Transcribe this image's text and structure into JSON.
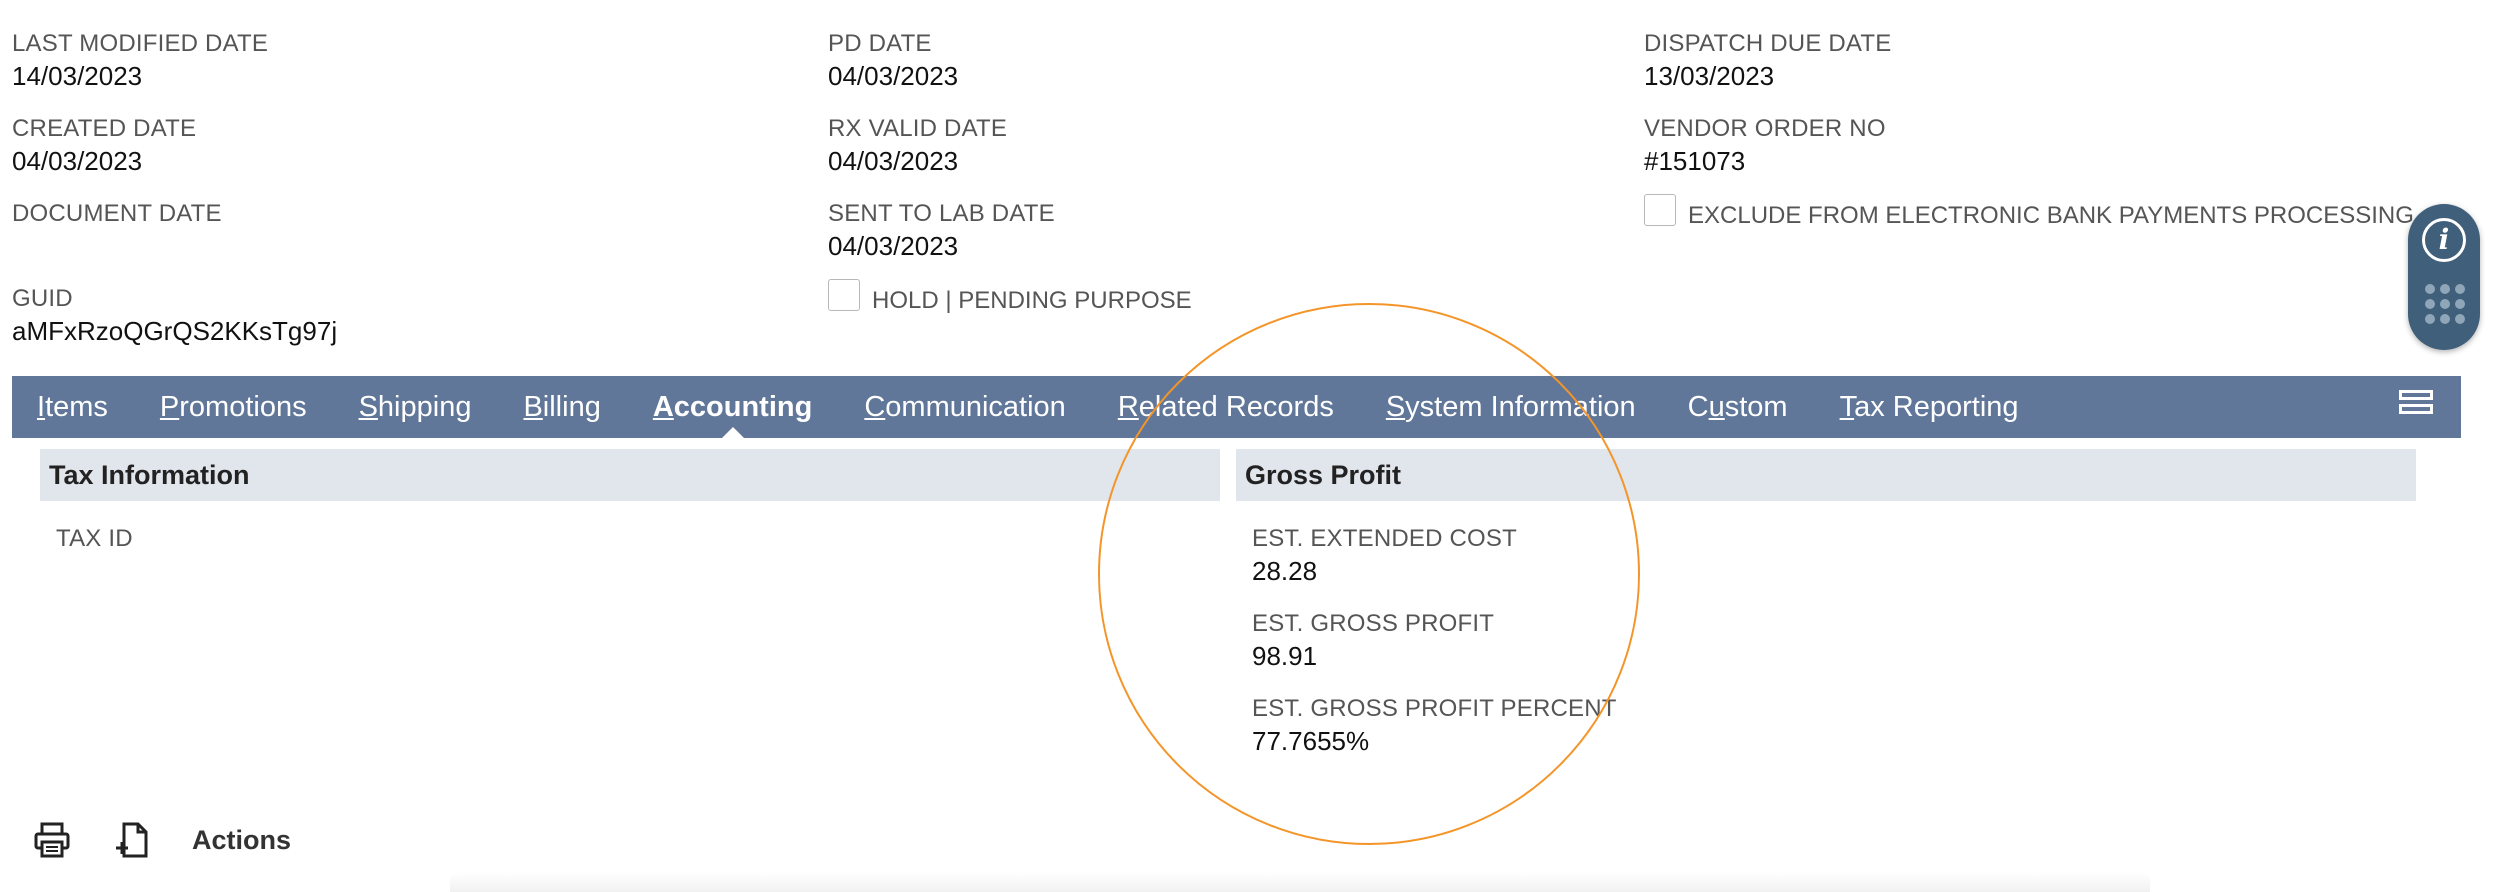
{
  "fields": {
    "last_modified": {
      "label": "LAST MODIFIED DATE",
      "value": "14/03/2023"
    },
    "created": {
      "label": "CREATED DATE",
      "value": "04/03/2023"
    },
    "document_date": {
      "label": "DOCUMENT DATE",
      "value": ""
    },
    "guid": {
      "label": "GUID",
      "value": "aMFxRzoQGrQS2KKsTg97j"
    },
    "pd_date": {
      "label": "PD DATE",
      "value": "04/03/2023"
    },
    "rx_valid": {
      "label": "RX VALID DATE",
      "value": "04/03/2023"
    },
    "sent_to_lab": {
      "label": "SENT TO LAB DATE",
      "value": "04/03/2023"
    },
    "dispatch_due": {
      "label": "DISPATCH DUE DATE",
      "value": "13/03/2023"
    },
    "vendor_order": {
      "label": "VENDOR ORDER NO",
      "value": "#151073"
    }
  },
  "checkboxes": {
    "hold": {
      "label": "HOLD | PENDING PURPOSE",
      "checked": false
    },
    "exclude_bank": {
      "label": "EXCLUDE FROM ELECTRONIC BANK PAYMENTS PROCESSING",
      "checked": false
    }
  },
  "tabs": [
    {
      "first": "I",
      "rest": "tems"
    },
    {
      "first": "P",
      "rest": "romotions"
    },
    {
      "first": "S",
      "rest": "hipping"
    },
    {
      "first": "B",
      "rest": "illing"
    },
    {
      "first": "A",
      "rest": "ccounting"
    },
    {
      "first": "C",
      "rest": "ommunication"
    },
    {
      "first": "R",
      "rest": "elated Records"
    },
    {
      "first": "S",
      "rest": "ystem Information"
    },
    {
      "pre": "C",
      "first": "u",
      "rest": "stom"
    },
    {
      "first": "T",
      "rest": "ax Reporting"
    }
  ],
  "active_tab": "Accounting",
  "tax_section": {
    "title": "Tax Information",
    "tax_id_label": "TAX ID"
  },
  "gross_section": {
    "title": "Gross Profit",
    "ext_cost": {
      "label": "EST. EXTENDED COST",
      "value": "28.28"
    },
    "gross_profit": {
      "label": "EST. GROSS PROFIT",
      "value": "98.91"
    },
    "gross_pct": {
      "label": "EST. GROSS PROFIT PERCENT",
      "value": "77.7655%"
    }
  },
  "footer": {
    "actions_label": "Actions",
    "icons": [
      "print-icon",
      "new-document-icon"
    ]
  },
  "side_widget": {
    "icons": [
      "info-icon",
      "grid-dots-icon"
    ]
  },
  "colors": {
    "tabbar": "#607799",
    "highlight_circle": "#f4952a",
    "section_header": "#e1e5ec"
  }
}
